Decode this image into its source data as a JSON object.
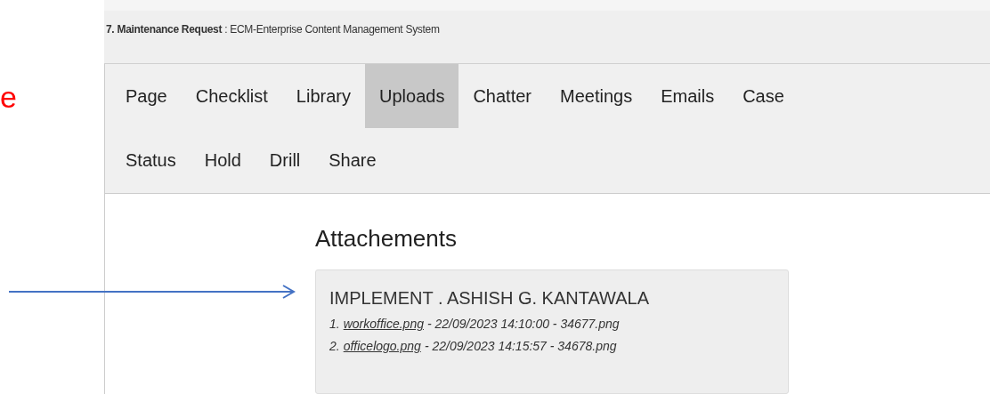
{
  "annotation": {
    "text": "e"
  },
  "header": {
    "title": "**7. Maintenance Request** : ECM-Enterprise Content Management System"
  },
  "tab_rows": [
    [
      {
        "label": "Page",
        "selected": false
      },
      {
        "label": "Checklist",
        "selected": false
      },
      {
        "label": "Library",
        "selected": false
      },
      {
        "label": "Uploads",
        "selected": true
      },
      {
        "label": "Chatter",
        "selected": false
      },
      {
        "label": "Meetings",
        "selected": false
      },
      {
        "label": "Emails",
        "selected": false
      },
      {
        "label": "Case",
        "selected": false
      }
    ],
    [
      {
        "label": "Status",
        "selected": false
      },
      {
        "label": "Hold",
        "selected": false
      },
      {
        "label": "Drill",
        "selected": false
      },
      {
        "label": "Share",
        "selected": false
      }
    ]
  ],
  "attachments": {
    "heading": "Attachements",
    "card_title": "IMPLEMENT . ASHISH G. KANTAWALA",
    "files": [
      {
        "index": "1.",
        "link": "workoffice.png",
        "details": "- 22/09/2023 14:10:00 - 34677.png"
      },
      {
        "index": "2.",
        "link": "officelogo.png",
        "details": "- 22/09/2023 14:15:57 - 34678.png"
      }
    ]
  }
}
